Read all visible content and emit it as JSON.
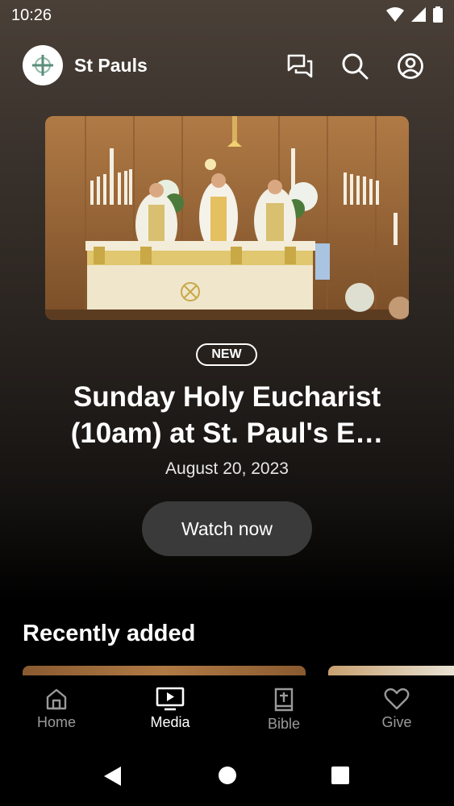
{
  "status_bar": {
    "time": "10:26",
    "icons": [
      "wifi-icon",
      "signal-icon",
      "battery-icon"
    ]
  },
  "header": {
    "church_name": "St Pauls",
    "icons": [
      "chat-icon",
      "search-icon",
      "account-icon"
    ]
  },
  "featured": {
    "badge": "NEW",
    "title_line1": "Sunday Holy Eucharist",
    "title_line2": "(10am) at St. Paul's E…",
    "date": "August 20, 2023",
    "watch_label": "Watch now"
  },
  "recently_added": {
    "heading": "Recently added"
  },
  "bottom_nav": {
    "items": [
      {
        "label": "Home",
        "icon": "home-icon",
        "active": false
      },
      {
        "label": "Media",
        "icon": "media-icon",
        "active": true
      },
      {
        "label": "Bible",
        "icon": "bible-icon",
        "active": false
      },
      {
        "label": "Give",
        "icon": "heart-icon",
        "active": false
      }
    ]
  },
  "colors": {
    "background": "#000000",
    "button": "#3a3a3a",
    "inactive_nav": "#9a9a9a"
  }
}
